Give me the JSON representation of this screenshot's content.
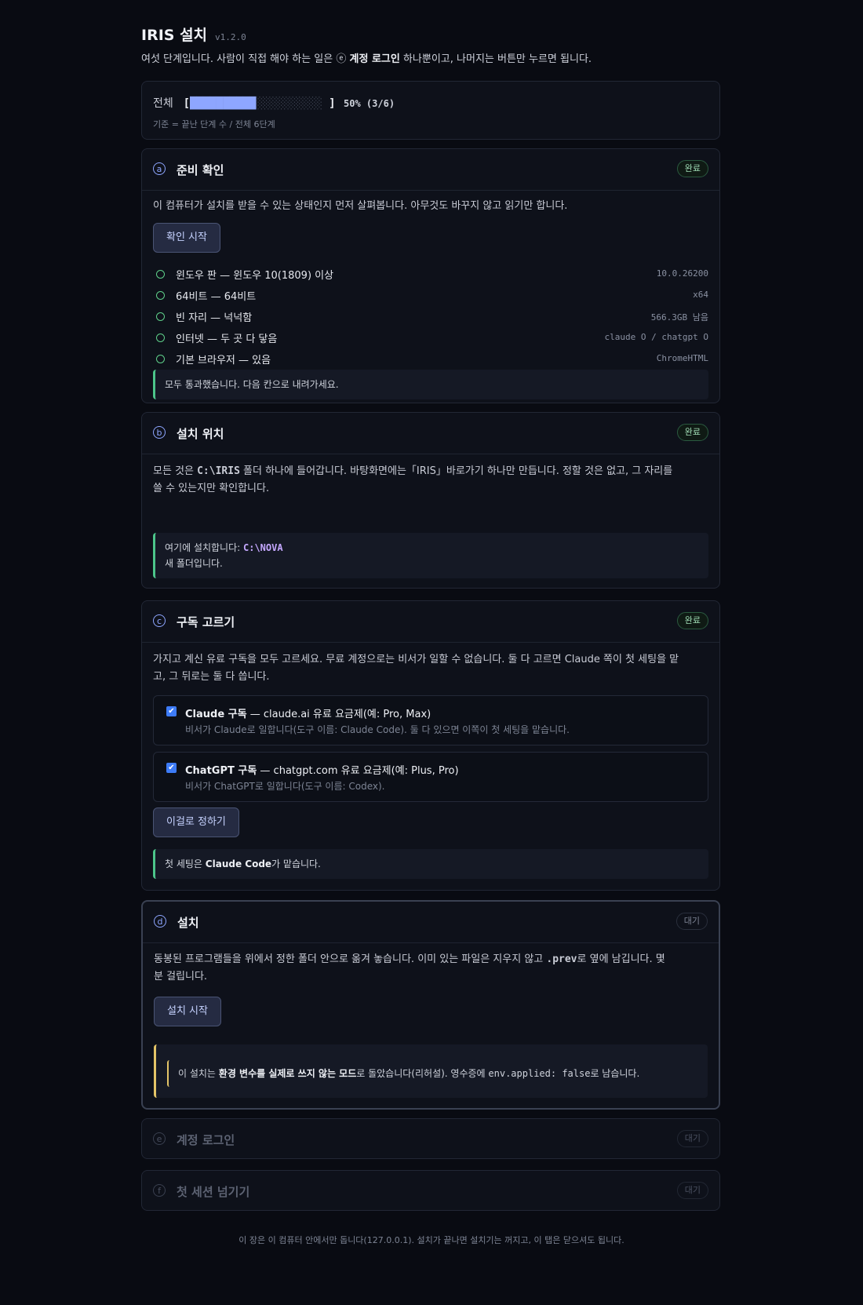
{
  "header": {
    "title": "IRIS 설치",
    "version": "v1.2.0",
    "intro_pre": "여섯 단계입니다. 사람이 직접 해야 하는 일은 ",
    "intro_step_icon": "ⓔ",
    "intro_bold": "계정 로그인",
    "intro_post": " 하나뿐이고, 나머지는 버튼만 누르면 됩니다."
  },
  "progress": {
    "label": "전체",
    "bracket_open": "[",
    "filled": "██████████",
    "empty": "░░░░░░░░░░",
    "bracket_close": "]",
    "percent_text": "50% (3/6)",
    "value": 0.5,
    "note": "기준 = 끝난 단계 수 / 전체 6단계"
  },
  "steps": [
    {
      "icon": "a",
      "title": "준비 확인",
      "status": "완료",
      "description": "이 컴퓨터가 설치를 받을 수 있는 상태인지 먼저 살펴봅니다. 아무것도 바꾸지 않고 읽기만 합니다.",
      "button": "확인 시작",
      "checks": [
        {
          "label": "윈도우 판 — 윈도우 10(1809) 이상",
          "value": "10.0.26200"
        },
        {
          "label": "64비트 — 64비트",
          "value": "x64"
        },
        {
          "label": "빈 자리 — 넉넉함",
          "value": "566.3GB 남음"
        },
        {
          "label": "인터넷 — 두 곳 다 닿음",
          "value": "claude O / chatgpt O"
        },
        {
          "label": "기본 브라우저 — 있음",
          "value": "ChromeHTML"
        }
      ],
      "note": "모두 통과했습니다. 다음 칸으로 내려가세요."
    },
    {
      "icon": "b",
      "title": "설치 위치",
      "status": "완료",
      "desc_pre": "모든 것은 ",
      "desc_code": "C:\\IRIS",
      "desc_post": " 폴더 하나에 들어갑니다. 바탕화면에는「IRIS」바로가기 하나만 만듭니다. 정할 것은 없고, 그 자리를",
      "desc_line2": "쓸 수 있는지만 확인합니다.",
      "note_pre": "여기에 설치합니다: ",
      "note_path": "C:\\NOVA",
      "note_line2": "새 폴더입니다."
    },
    {
      "icon": "c",
      "title": "구독 고르기",
      "status": "완료",
      "desc_line1": "가지고 계신 유료 구독을 모두 고르세요. 무료 계정으로는 비서가 일할 수 없습니다. 둘 다 고르면 Claude 쪽이 첫 세팅을 맡",
      "desc_line2": "고, 그 뒤로는 둘 다 씁니다.",
      "options": [
        {
          "title_bold": "Claude 구독",
          "title_rest": " — claude.ai 유료 요금제(예: Pro, Max)",
          "sub": "비서가 Claude로 일합니다(도구 이름: Claude Code). 둘 다 있으면 이쪽이 첫 세팅을 맡습니다.",
          "checked": true
        },
        {
          "title_bold": "ChatGPT 구독",
          "title_rest": " — chatgpt.com 유료 요금제(예: Plus, Pro)",
          "sub": "비서가 ChatGPT로 일합니다(도구 이름: Codex).",
          "checked": true
        }
      ],
      "button": "이걸로 정하기",
      "note_pre": "첫 세팅은 ",
      "note_bold": "Claude Code",
      "note_post": "가 맡습니다."
    },
    {
      "icon": "d",
      "title": "설치",
      "status": "대기",
      "desc_pre": "동봉된 프로그램들을 위에서 정한 폴더 안으로 옮겨 놓습니다. 이미 있는 파일은 지우지 않고 ",
      "desc_code": ".prev",
      "desc_post": "로 옆에 남깁니다. 몇",
      "desc_line2": "분 걸립니다.",
      "button": "설치 시작",
      "note_pre": "이 설치는 ",
      "note_bold": "환경 변수를 실제로 쓰지 않는 모드",
      "note_mid": "로 돌았습니다(리허설). 영수증에 ",
      "note_code": "env.applied: false",
      "note_post": "로 남습니다."
    },
    {
      "icon": "e",
      "title": "계정 로그인",
      "status": "대기"
    },
    {
      "icon": "f",
      "title": "첫 세션 넘기기",
      "status": "대기"
    }
  ],
  "footer": "이 장은 이 컴퓨터 안에서만 돕니다(127.0.0.1). 설치가 끝나면 설치기는 꺼지고, 이 탭은 닫으셔도 됩니다.",
  "colors": {
    "background": "#090b12",
    "accent": "#8ea6ff",
    "success": "#4cc58a",
    "warning": "#e3c467",
    "checkbox": "#3d7bf7"
  }
}
